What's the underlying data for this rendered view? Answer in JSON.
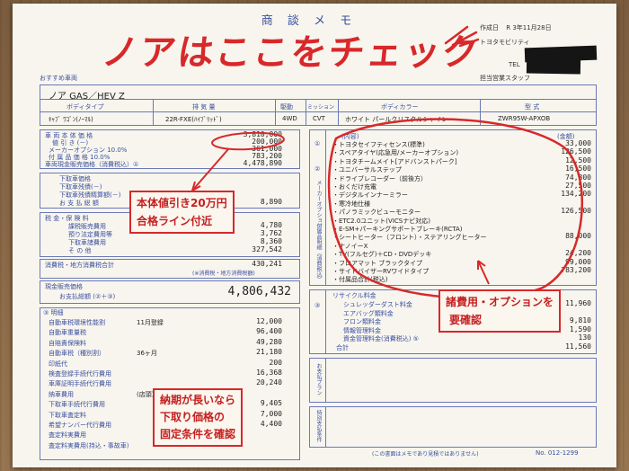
{
  "header": {
    "form_title": "商 談 メ モ",
    "handwritten_title": "ノアはここをチェック",
    "date_label": "作成日",
    "date_value": "R 3年11月28日",
    "dealer": "トヨタモビリティ",
    "tel_label": "TEL",
    "staff_label": "担当営業スタッフ",
    "recommended_label": "おすすめ車両"
  },
  "vehicle": {
    "name": "ノア GAS／HEV Z",
    "col_headers": [
      "ボディタイプ",
      "排 気 量",
      "駆動",
      "ミッション",
      "ボディカラー",
      "型 式"
    ],
    "body_type": "ｷｬﾌﾞ ﾜｺﾞﾝ(ﾉｰﾏﾙ)",
    "engine": "22R-FXE(ﾊｲﾌﾞﾘｯﾄﾞ)",
    "drive": "4WD",
    "transmission": "CVT",
    "color": "ホワイト パールクリスタルシャイン",
    "model_code": "ZWR95W-APXOB"
  },
  "price_block": {
    "rows": [
      {
        "label": "車 両 本 体 価 格",
        "value": "3,810,000"
      },
      {
        "label": "値 引 き (－)",
        "value": "200,000"
      },
      {
        "label": "メーカーオプション 10.0%",
        "value": "361,000"
      },
      {
        "label": "付 属 品 価 格 10.0%",
        "value": "783,200"
      },
      {
        "label": "車両現金販売価格（消費税込）①",
        "value": "4,478,890"
      }
    ],
    "tradein_rows": [
      {
        "label": "下取車価格",
        "value": ""
      },
      {
        "label": "下取車残債(－)",
        "value": ""
      },
      {
        "label": "下取車残債精算額(－)",
        "value": ""
      },
      {
        "label": "お 支 払 総 額",
        "value": "8,890"
      }
    ],
    "tax_rows": [
      {
        "label": "税 金・保 険 料",
        "value": ""
      },
      {
        "label": "課税販売費用",
        "value": "4,780"
      },
      {
        "label": "預り法定費用等",
        "value": "3,762"
      },
      {
        "label": "下取車諸費用",
        "value": "8,360"
      },
      {
        "label": "そ の 他",
        "value": "327,542"
      }
    ],
    "consumption_tax_label": "消費税・地方消費税合計",
    "consumption_tax_value": "430,241",
    "consumption_tax_note": "(※消費税・地方消費税額)",
    "cash_label": "現金販売価格",
    "payment_label": "お支払総額 (②＋③)",
    "payment_value": "4,806,432"
  },
  "details": {
    "title": "③ 明細",
    "rows": [
      {
        "label": "自動車税環境性能割",
        "note": "11月登録",
        "value": "12,000"
      },
      {
        "label": "自動車重量税",
        "note": "",
        "value": "96,400"
      },
      {
        "label": "自賠責保険料",
        "note": "",
        "value": "49,280"
      },
      {
        "label": "自動車税（種別割）",
        "note": "36ヶ月",
        "value": "21,180"
      },
      {
        "label": "印紙代",
        "note": "",
        "value": "200"
      },
      {
        "label": "検査登録手続代行費用",
        "note": "",
        "value": "16,368"
      },
      {
        "label": "車庫証明手続代行費用",
        "note": "",
        "value": "20,240"
      },
      {
        "label": "納車費用",
        "note": "(店頭)",
        "value": ""
      },
      {
        "label": "下取車手続代行費用",
        "note": "",
        "value": "9,405"
      },
      {
        "label": "下取車査定料",
        "note": "",
        "value": "7,000"
      },
      {
        "label": "希望ナンバー代行費用",
        "note": "",
        "value": "4,400"
      },
      {
        "label": "査定料実費用",
        "note": "",
        "value": ""
      },
      {
        "label": "査定料実費用(持込・事故車)",
        "note": "",
        "value": ""
      }
    ]
  },
  "options": {
    "col_name": "(内容)",
    "col_price": "(金額)",
    "side_labels": [
      "①",
      "②",
      "メーカーオプション",
      "付属品明細（消費税込）"
    ],
    "rows": [
      {
        "label": "・トヨタセイフティセンス(標準)",
        "value": "33,000"
      },
      {
        "label": "・スペアタイヤ(応急用/メーカーオプション)",
        "value": "126,500"
      },
      {
        "label": "・トヨタチームメイト[アドバンストパーク]",
        "value": "12,500"
      },
      {
        "label": "・ユニバーサルステップ",
        "value": "16,500"
      },
      {
        "label": "・ドライブレコーダー（前後方）",
        "value": "74,800"
      },
      {
        "label": "・おくだけ充電",
        "value": "27,500"
      },
      {
        "label": "・デジタルインナーミラー",
        "value": "134,200"
      },
      {
        "label": "・寒冷地仕様",
        "value": ""
      },
      {
        "label": "・パノラミックビューモニター",
        "value": "126,500"
      },
      {
        "label": "・ETC2.0ユニット(VICSナビ対応)",
        "value": ""
      },
      {
        "label": "・E-SM+パーキングサポートブレーキ(RCTA)",
        "value": ""
      },
      {
        "label": "・シートヒーター（フロント）・ステアリングヒーター",
        "value": "88,000"
      },
      {
        "label": "・ナノイーX",
        "value": ""
      },
      {
        "label": "・TV(フルセグ)＋CD・DVDデッキ",
        "value": "24,200"
      },
      {
        "label": "・フロアマット ブラックタイプ",
        "value": "99,000"
      },
      {
        "label": "・サイドバイザーRVワイドタイプ",
        "value": "783,200"
      },
      {
        "label": "・付属品合計(税込)",
        "value": ""
      }
    ]
  },
  "recycle": {
    "title": "リサイクル料金",
    "rows": [
      {
        "label": "シュレッダーダスト料金",
        "value": "11,960"
      },
      {
        "label": "エアバッグ類料金",
        "value": ""
      },
      {
        "label": "フロン類料金",
        "value": "9,810"
      },
      {
        "label": "情報管理料金",
        "value": "1,590"
      },
      {
        "label": "資金管理料金(消費税込) ⑤",
        "value": "130"
      },
      {
        "label": "合計",
        "value": "11,560"
      }
    ],
    "index": "③"
  },
  "side_boxes": [
    {
      "label": "お支払プラン"
    },
    {
      "label": "特別支払条件"
    }
  ],
  "footer": {
    "note": "(この書面はメモであり見積ではありません)",
    "number": "No. 012-1299"
  },
  "annotations": {
    "discount_note": [
      "本体値引き20万円",
      "合格ライン付近"
    ],
    "options_note": [
      "諸費用・オプションを",
      "要確認"
    ],
    "tradein_note": [
      "納期が長いなら",
      "下取り価格の",
      "固定条件を確認"
    ]
  },
  "colors": {
    "ink_red": "#d8282a",
    "form_blue": "#3b4f9e",
    "paper": "#f7f5ee"
  }
}
